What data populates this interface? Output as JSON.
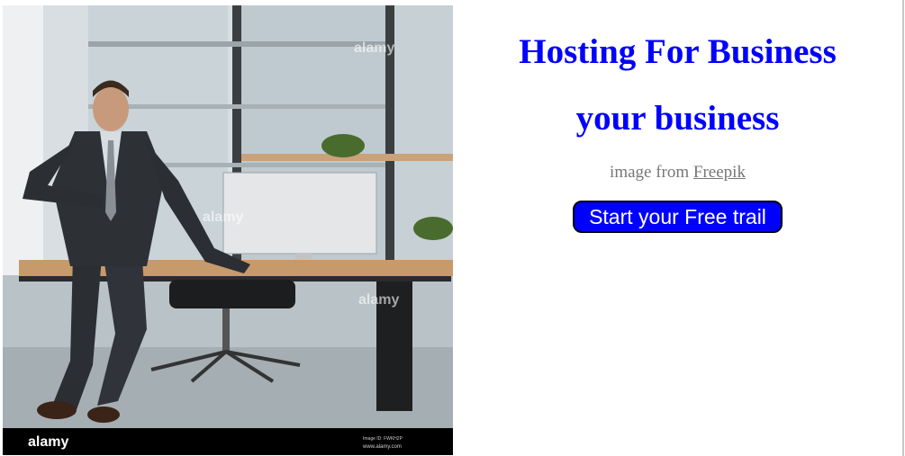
{
  "photo": {
    "watermark_top": "alamy",
    "watermark_mid": "alamy",
    "watermark_low": "alamy",
    "footer_logo": "alamy",
    "footer_small_1": "Image ID: FWKH2P",
    "footer_small_2": "www.alamy.com"
  },
  "hero": {
    "title_line1": "Hosting For Business",
    "title_line2": "your business",
    "credit_prefix": "image from ",
    "credit_link": "Freepik",
    "cta_label": "Start your Free trail"
  },
  "colors": {
    "accent": "#0000ff",
    "credit_text": "#777777",
    "button_text": "#ffffff"
  }
}
